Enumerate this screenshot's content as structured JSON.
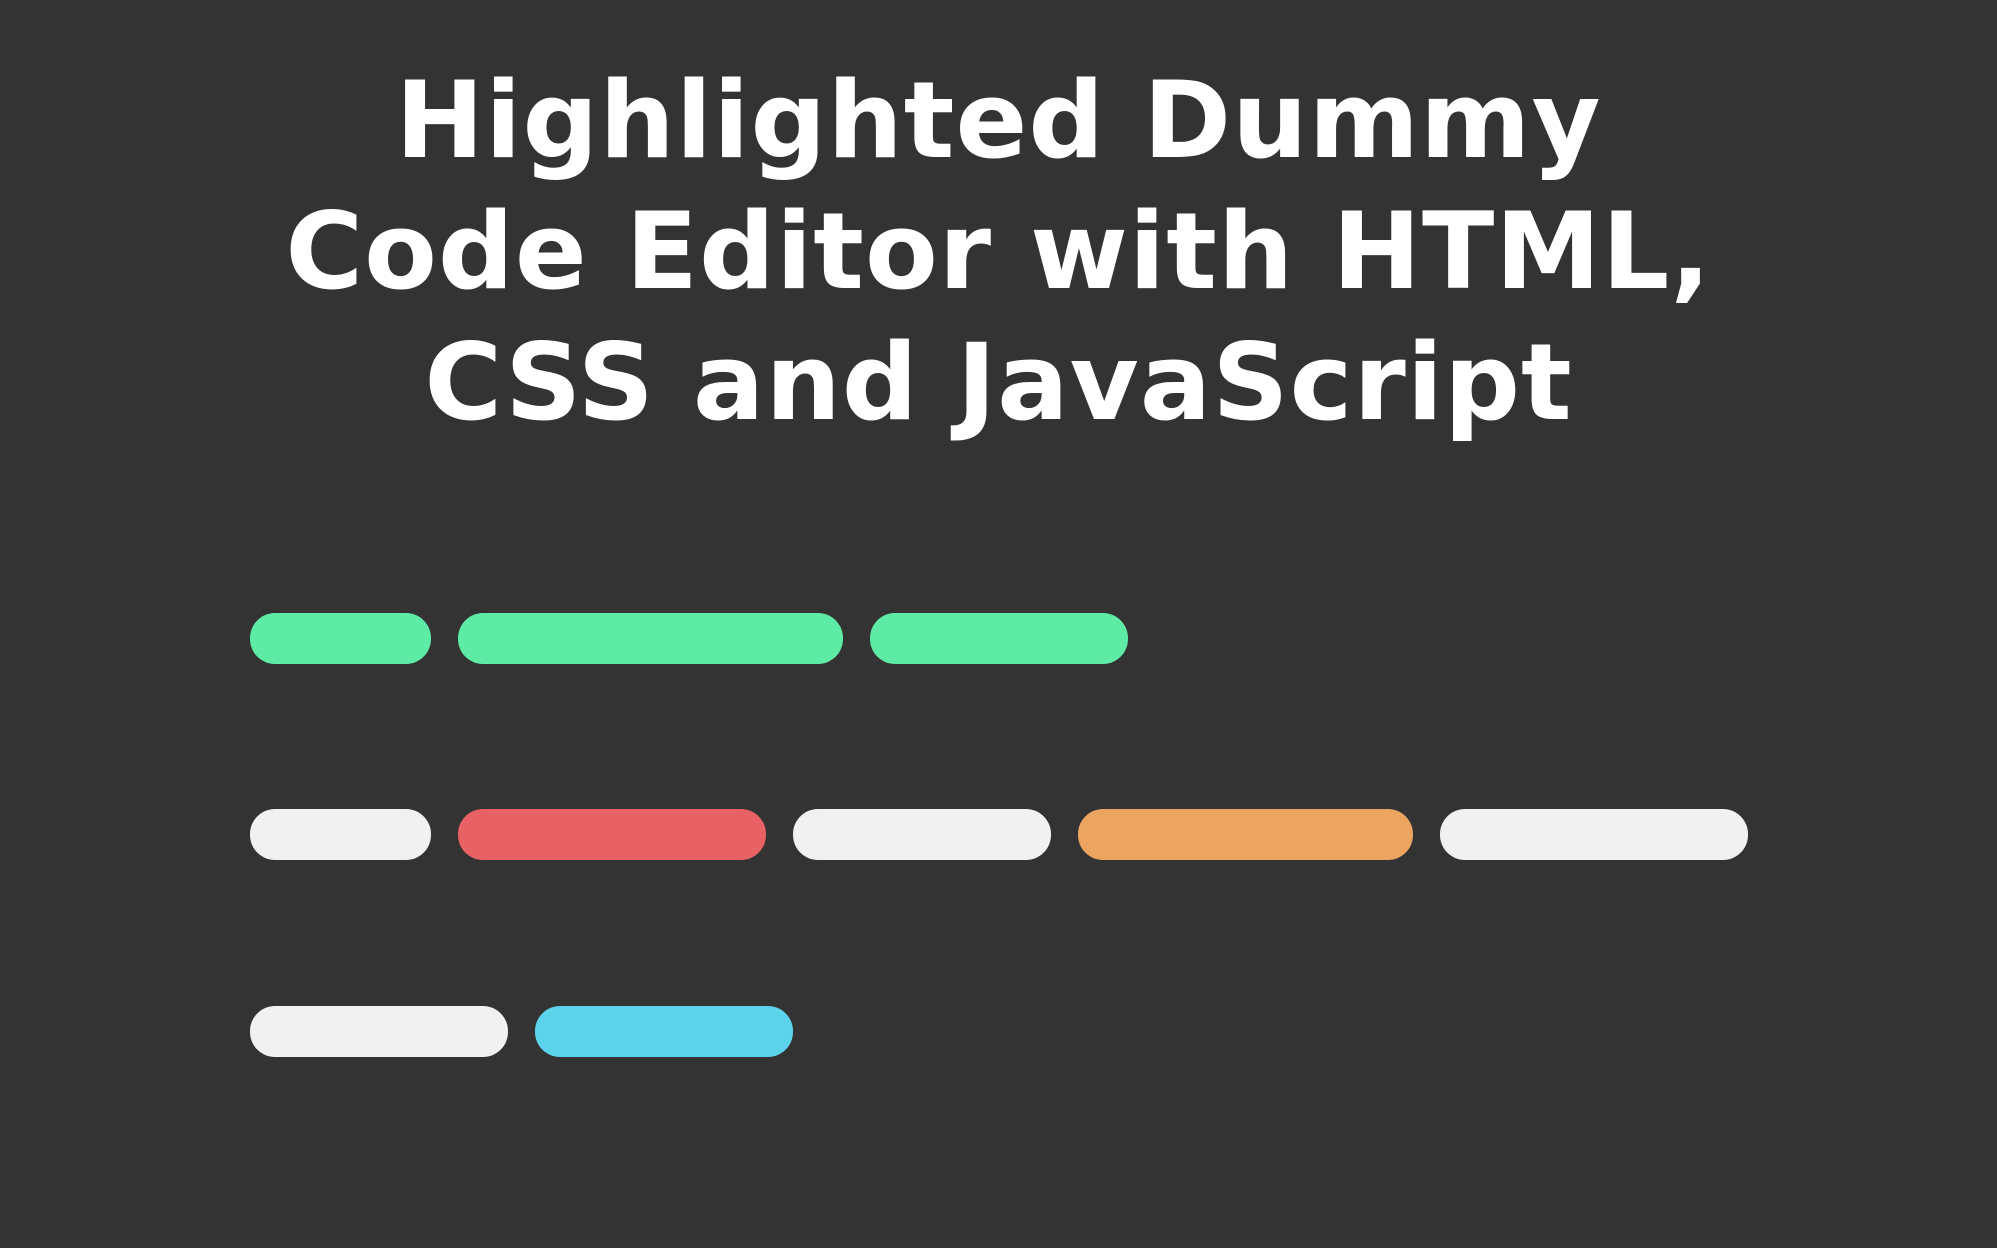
{
  "title": {
    "lines": [
      "Highlighted Dummy",
      "Code Editor with HTML,",
      "CSS and JavaScript"
    ]
  },
  "colors": {
    "background": "#333333",
    "title_text": "#ffffff",
    "green": "#5deba5",
    "white": "#f1f1f1",
    "red": "#e86164",
    "orange": "#eba560",
    "cyan": "#5bd3ea"
  },
  "code_lines": [
    {
      "tokens": [
        {
          "color": "green"
        },
        {
          "color": "green"
        },
        {
          "color": "green"
        }
      ]
    },
    {
      "tokens": [
        {
          "color": "white"
        },
        {
          "color": "red"
        },
        {
          "color": "white"
        },
        {
          "color": "orange"
        },
        {
          "color": "white"
        }
      ]
    },
    {
      "tokens": [
        {
          "color": "white"
        },
        {
          "color": "cyan"
        }
      ]
    }
  ]
}
